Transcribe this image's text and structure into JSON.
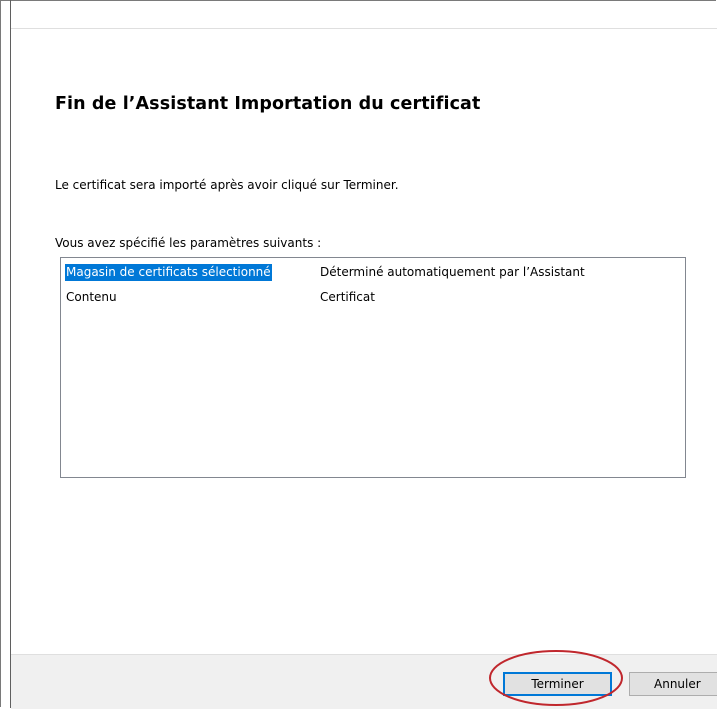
{
  "wizard": {
    "title": "Fin de l’Assistant Importation du certificat",
    "info_text": "Le certificat sera importé après avoir cliqué sur Terminer.",
    "params_label": "Vous avez spécifié les paramètres suivants :",
    "settings": [
      {
        "key": "Magasin de certificats sélectionné",
        "value": "Déterminé automatiquement par l’Assistant",
        "selected": true
      },
      {
        "key": "Contenu",
        "value": "Certificat",
        "selected": false
      }
    ]
  },
  "buttons": {
    "finish_label": "Terminer",
    "cancel_label": "Annuler"
  },
  "colors": {
    "selection": "#0078d7",
    "annotation": "#c0272d",
    "footer_bg": "#f0f0f0"
  }
}
